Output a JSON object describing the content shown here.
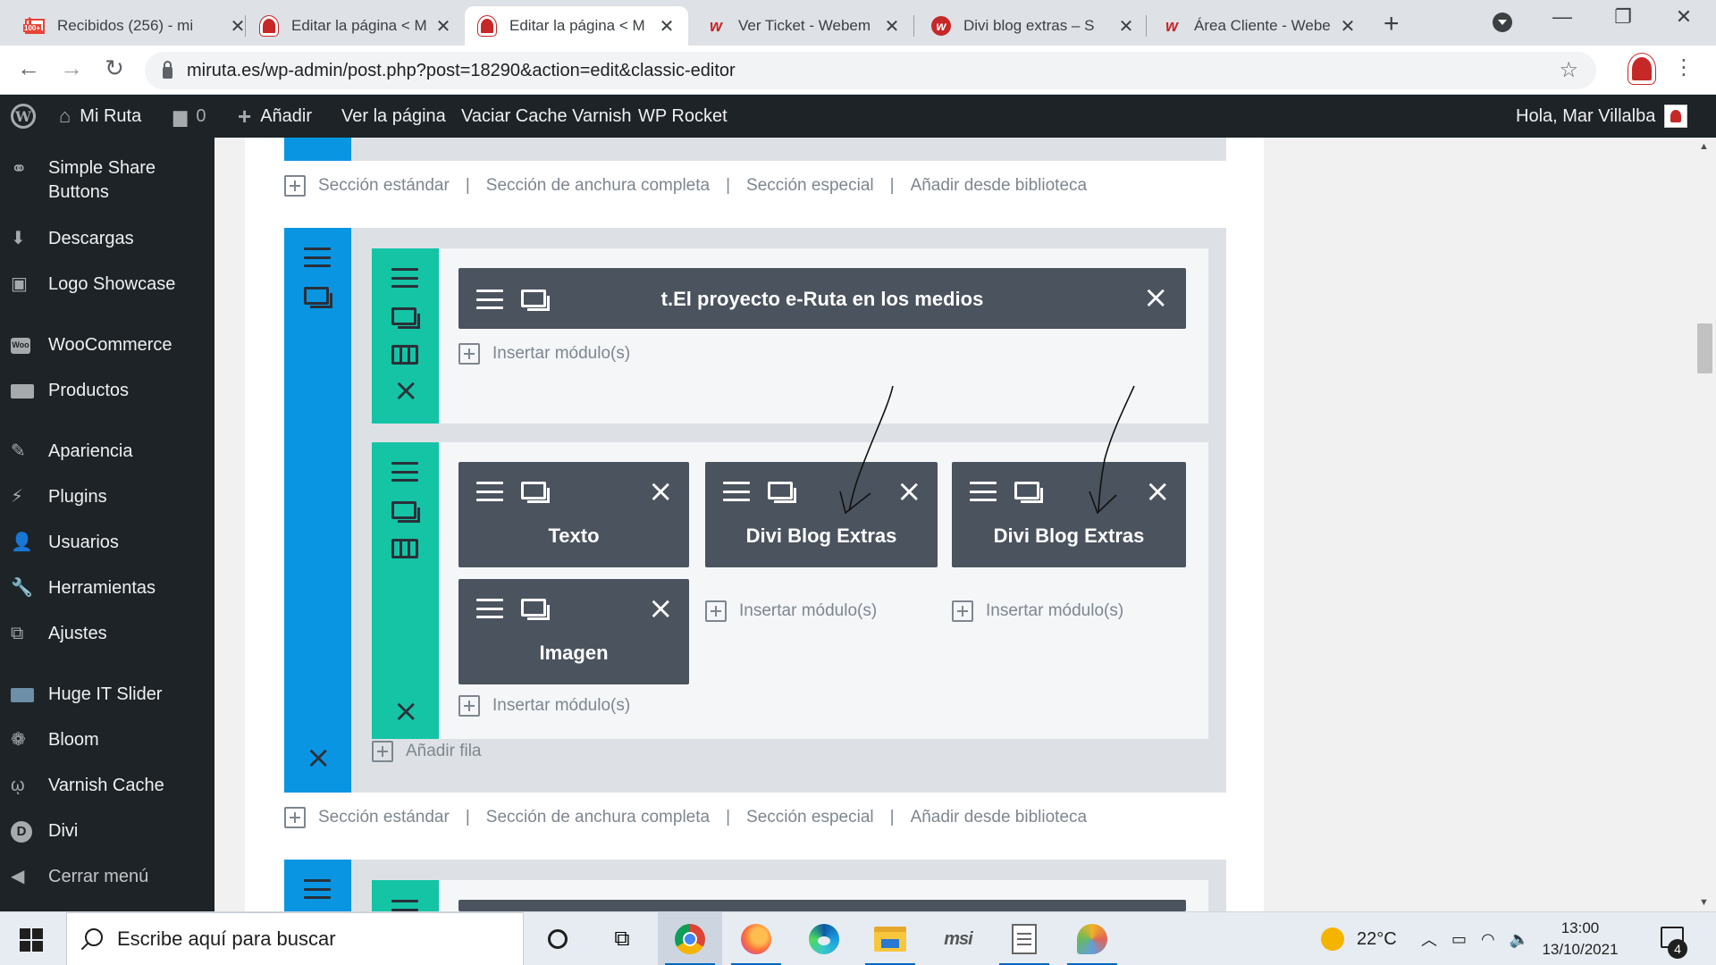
{
  "browser": {
    "tabs": [
      {
        "title": "Recibidos (256) - mi",
        "favicon": "gmail-icon"
      },
      {
        "title": "Editar la página < M",
        "favicon": "miruta-icon"
      },
      {
        "title": "Editar la página < M",
        "favicon": "miruta-icon",
        "active": true
      },
      {
        "title": "Ver Ticket - Webem",
        "favicon": "webempresa-icon"
      },
      {
        "title": "Divi blog extras – S",
        "favicon": "webempresa-round-icon"
      },
      {
        "title": "Área Cliente - Webe",
        "favicon": "webempresa-icon"
      }
    ],
    "gmail_badge": "100+",
    "url": "miruta.es/wp-admin/post.php?post=18290&action=edit&classic-editor"
  },
  "adminbar": {
    "site_name": "Mi Ruta",
    "comments_count": "0",
    "add_new": "Añadir",
    "view_page": "Ver la página",
    "varnish": "Vaciar Cache Varnish",
    "wp_rocket": "WP Rocket",
    "greeting": "Hola, Mar Villalba"
  },
  "sidebar": {
    "items": [
      {
        "label": "Simple Share Buttons",
        "icon": "share-icon"
      },
      {
        "label": "Descargas",
        "icon": "download-icon"
      },
      {
        "label": "Logo Showcase",
        "icon": "images-icon"
      },
      {
        "label": "WooCommerce",
        "icon": "woo-icon"
      },
      {
        "label": "Productos",
        "icon": "archive-icon"
      },
      {
        "label": "Apariencia",
        "icon": "brush-icon"
      },
      {
        "label": "Plugins",
        "icon": "plug-icon"
      },
      {
        "label": "Usuarios",
        "icon": "user-icon"
      },
      {
        "label": "Herramientas",
        "icon": "wrench-icon"
      },
      {
        "label": "Ajustes",
        "icon": "settings-icon"
      },
      {
        "label": "Huge IT Slider",
        "icon": "slider-icon"
      },
      {
        "label": "Bloom",
        "icon": "bloom-icon"
      },
      {
        "label": "Varnish Cache",
        "icon": "varnish-icon"
      },
      {
        "label": "Divi",
        "icon": "divi-icon"
      },
      {
        "label": "Cerrar menú",
        "icon": "collapse-icon"
      }
    ]
  },
  "builder": {
    "section_links": {
      "standard": "Sección estándar",
      "fullwidth": "Sección de anchura completa",
      "special": "Sección especial",
      "library": "Añadir desde biblioteca",
      "separator": "|"
    },
    "insert_module": "Insertar módulo(s)",
    "add_row": "Añadir fila",
    "row1_module": "t.El proyecto e-Ruta en los medios",
    "row2_modules": {
      "col1_top": "Texto",
      "col1_bottom": "Imagen",
      "col2": "Divi Blog Extras",
      "col3": "Divi Blog Extras"
    }
  },
  "taskbar": {
    "search_placeholder": "Escribe aquí para buscar",
    "temperature": "22°C",
    "time": "13:00",
    "date": "13/10/2021",
    "notifications": "4"
  }
}
